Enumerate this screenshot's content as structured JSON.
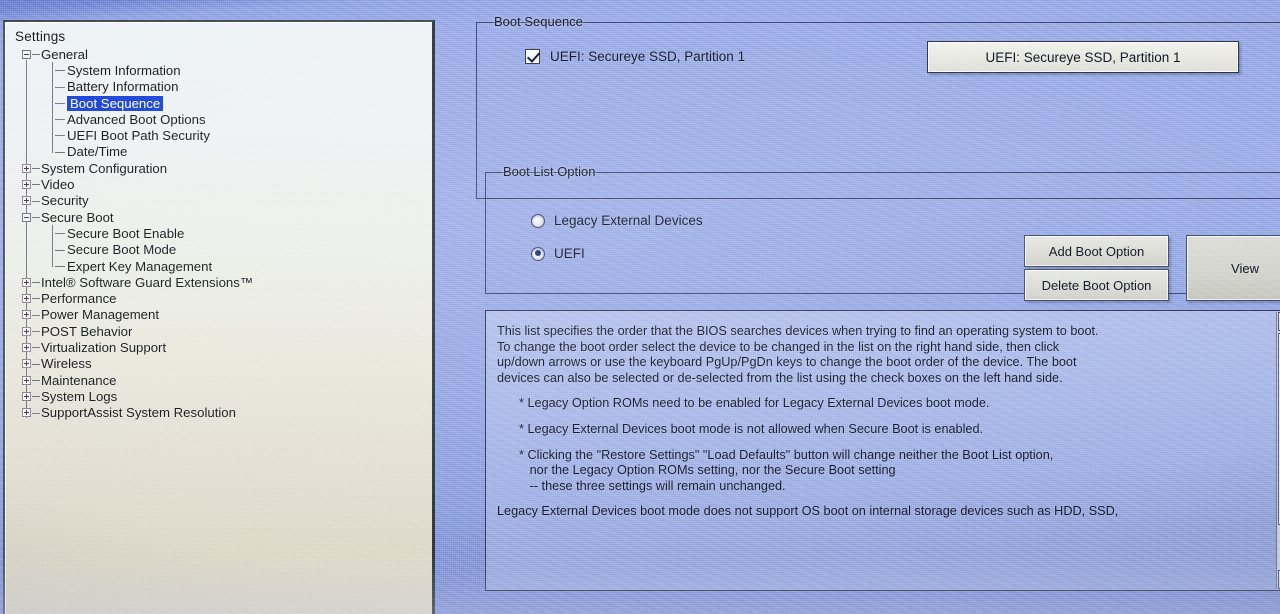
{
  "sidebar": {
    "title": "Settings",
    "items": [
      {
        "label": "General",
        "level": 0,
        "expander": "minus",
        "selected": false
      },
      {
        "label": "System Information",
        "level": 1,
        "expander": "none",
        "selected": false
      },
      {
        "label": "Battery Information",
        "level": 1,
        "expander": "none",
        "selected": false
      },
      {
        "label": "Boot Sequence",
        "level": 1,
        "expander": "none",
        "selected": true
      },
      {
        "label": "Advanced Boot Options",
        "level": 1,
        "expander": "none",
        "selected": false
      },
      {
        "label": "UEFI Boot Path Security",
        "level": 1,
        "expander": "none",
        "selected": false
      },
      {
        "label": "Date/Time",
        "level": 1,
        "expander": "none",
        "selected": false
      },
      {
        "label": "System Configuration",
        "level": 0,
        "expander": "plus",
        "selected": false
      },
      {
        "label": "Video",
        "level": 0,
        "expander": "plus",
        "selected": false
      },
      {
        "label": "Security",
        "level": 0,
        "expander": "plus",
        "selected": false
      },
      {
        "label": "Secure Boot",
        "level": 0,
        "expander": "minus",
        "selected": false
      },
      {
        "label": "Secure Boot Enable",
        "level": 1,
        "expander": "none",
        "selected": false
      },
      {
        "label": "Secure Boot Mode",
        "level": 1,
        "expander": "none",
        "selected": false
      },
      {
        "label": "Expert Key Management",
        "level": 1,
        "expander": "none",
        "selected": false
      },
      {
        "label": "Intel® Software Guard Extensions™",
        "level": 0,
        "expander": "plus",
        "selected": false
      },
      {
        "label": "Performance",
        "level": 0,
        "expander": "plus",
        "selected": false
      },
      {
        "label": "Power Management",
        "level": 0,
        "expander": "plus",
        "selected": false
      },
      {
        "label": "POST Behavior",
        "level": 0,
        "expander": "plus",
        "selected": false
      },
      {
        "label": "Virtualization Support",
        "level": 0,
        "expander": "plus",
        "selected": false
      },
      {
        "label": "Wireless",
        "level": 0,
        "expander": "plus",
        "selected": false
      },
      {
        "label": "Maintenance",
        "level": 0,
        "expander": "plus",
        "selected": false
      },
      {
        "label": "System Logs",
        "level": 0,
        "expander": "plus",
        "selected": false
      },
      {
        "label": "SupportAssist System Resolution",
        "level": 0,
        "expander": "plus",
        "selected": false
      }
    ]
  },
  "boot_sequence": {
    "legend": "Boot Sequence",
    "entries": [
      {
        "label": "UEFI: Secureye SSD, Partition 1",
        "checked": true
      }
    ],
    "selected_device_button": "UEFI: Secureye SSD, Partition 1"
  },
  "boot_list_option": {
    "legend": "Boot List Option",
    "options": [
      {
        "label": "Legacy External Devices",
        "selected": false
      },
      {
        "label": "UEFI",
        "selected": true
      }
    ],
    "buttons": {
      "add": "Add Boot Option",
      "delete": "Delete Boot Option",
      "view": "View"
    }
  },
  "description": {
    "paragraphs": [
      {
        "bullet": false,
        "text": "This list specifies the order that the BIOS searches devices when trying to find an operating system to boot.\nTo change the boot order select the device to be changed in the list on the right hand side, then click\nup/down arrows or use the keyboard PgUp/PgDn keys to change the boot order of the device. The boot\ndevices can also be selected or de-selected from the list using the check boxes on the left hand side."
      },
      {
        "bullet": true,
        "text": "* Legacy Option ROMs need to be enabled for Legacy External Devices boot mode."
      },
      {
        "bullet": true,
        "text": "* Legacy External Devices boot mode is not allowed when Secure Boot is enabled."
      },
      {
        "bullet": true,
        "text": "* Clicking the \"Restore Settings\" \"Load Defaults\" button will change neither the Boot List option,\n   nor the Legacy Option ROMs setting, nor the Secure Boot setting\n   -- these three settings will remain unchanged."
      },
      {
        "bullet": false,
        "text": "Legacy External Devices boot mode does not support OS boot on internal storage devices such as HDD, SSD,"
      }
    ],
    "scrollbar": {
      "up_icon": "scroll-up-arrow",
      "down_icon": "scroll-down-arrow"
    }
  },
  "colors": {
    "desktop_blue": "#9aace7",
    "panel_light": "#eef3f6",
    "selection_blue": "#1a43d8",
    "text_dark": "#15181d",
    "button_face": "#dcdcd6"
  }
}
